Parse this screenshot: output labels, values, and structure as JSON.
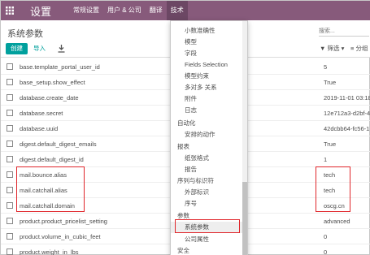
{
  "topbar": {
    "title": "设置",
    "menu": [
      "常规设置",
      "用户 & 公司",
      "翻译",
      "技术"
    ]
  },
  "control_panel": {
    "breadcrumb": "系统参数",
    "create_label": "创建",
    "import_label": "导入",
    "search_placeholder": "搜索...",
    "filter_label": "▼ 筛选 ▾",
    "group_label": "≡ 分组"
  },
  "rows": [
    {
      "key": "base.template_portal_user_id",
      "value": "5"
    },
    {
      "key": "base_setup.show_effect",
      "value": "True"
    },
    {
      "key": "database.create_date",
      "value": "2019-11-01 03:18"
    },
    {
      "key": "database.secret",
      "value": "12e712a3-d2bf-4"
    },
    {
      "key": "database.uuid",
      "value": "42dcbb64-fc56-1"
    },
    {
      "key": "digest.default_digest_emails",
      "value": "True"
    },
    {
      "key": "digest.default_digest_id",
      "value": "1"
    },
    {
      "key": "mail.bounce.alias",
      "value": "tech"
    },
    {
      "key": "mail.catchall.alias",
      "value": "tech"
    },
    {
      "key": "mail.catchall.domain",
      "value": "oscg.cn"
    },
    {
      "key": "product.product_pricelist_setting",
      "value": "advanced"
    },
    {
      "key": "product.volume_in_cubic_feet",
      "value": "0"
    },
    {
      "key": "product.weight_in_lbs",
      "value": "0"
    }
  ],
  "dropdown": {
    "items": [
      {
        "label": "小数准确性",
        "level": 1
      },
      {
        "label": "模型",
        "level": 1
      },
      {
        "label": "字段",
        "level": 1
      },
      {
        "label": "Fields Selection",
        "level": 1
      },
      {
        "label": "模型约束",
        "level": 1
      },
      {
        "label": "多对多 关系",
        "level": 1
      },
      {
        "label": "附件",
        "level": 1
      },
      {
        "label": "日志",
        "level": 1
      },
      {
        "label": "自动化",
        "level": 0
      },
      {
        "label": "安排的动作",
        "level": 1
      },
      {
        "label": "报表",
        "level": 0
      },
      {
        "label": "纸张格式",
        "level": 1
      },
      {
        "label": "报告",
        "level": 1
      },
      {
        "label": "序列与标识符",
        "level": 0
      },
      {
        "label": "外部标识",
        "level": 1
      },
      {
        "label": "序号",
        "level": 1
      },
      {
        "label": "参数",
        "level": 0
      },
      {
        "label": "系统参数",
        "level": 1,
        "selected": true
      },
      {
        "label": "公司属性",
        "level": 1
      },
      {
        "label": "安全",
        "level": 0
      }
    ]
  },
  "colors": {
    "topbar": "#875a7b",
    "primary_button": "#00a09d",
    "highlight": "#e0262b"
  }
}
